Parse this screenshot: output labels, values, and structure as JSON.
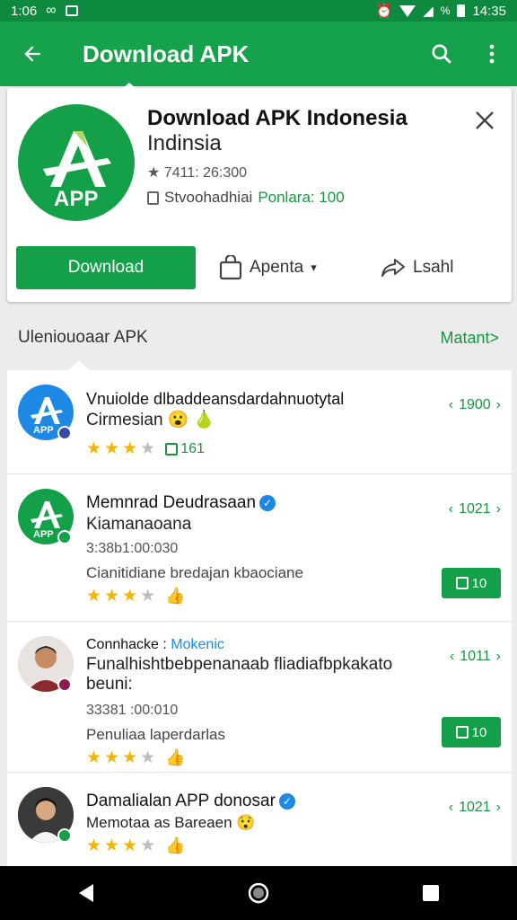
{
  "status_bar": {
    "time_left": "1:06",
    "battery_pct": "%",
    "time_right": "14:35"
  },
  "app_bar": {
    "title": "Download APK"
  },
  "card": {
    "icon_text": "APP",
    "title": "Download APK Indonesia",
    "subtitle": "Indinsia",
    "meta": "★ 7411: 26:300",
    "info_label": "Stvoohadhiai",
    "info_value": "Ponlara: 100",
    "download_label": "Download",
    "action_mid": "Apenta",
    "action_share": "Lsahl"
  },
  "section": {
    "title": "Uleniouoaar APK",
    "more": "Matant>"
  },
  "items": [
    {
      "title": "Vnuiolde dlbaddeansdardahnuotytal",
      "line2": "Cirmesian 😮 🍐",
      "rating_text": "161",
      "version": "1900",
      "icon_text": "APP"
    },
    {
      "title": "Memnrad Deudrasaan",
      "line2": "Kiamanaoana",
      "meta": "3:38b1:00:030",
      "desc": "Cianitidiane bredajan kbaociane",
      "version": "1021",
      "install": "10",
      "icon_text": "APP"
    },
    {
      "title": "Connhacke :",
      "title_tag": "Mokenic",
      "line2": "Funalhishtbebpenanaab fliadiafbpkakato",
      "line3": "beuni:",
      "meta": "33381 :00:010",
      "desc": "Penuliaa laperdarlas",
      "version": "1011",
      "install": "10"
    },
    {
      "title": "Damalialan APP donosar",
      "line2": "Memotaa as Bareaen 😯",
      "version": "1021"
    }
  ],
  "colors": {
    "primary": "#16a24c",
    "status": "#0d8a3f",
    "accent_text": "#18963f",
    "star": "#f5b400",
    "verified": "#1e88e5"
  }
}
